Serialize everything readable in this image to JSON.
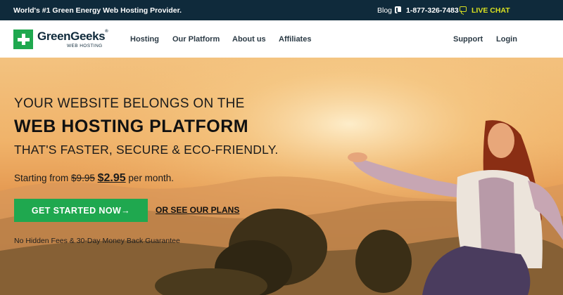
{
  "topbar": {
    "tagline": "World's #1 Green Energy Web Hosting Provider.",
    "blog": "Blog",
    "phone": "1-877-326-7483",
    "livechat": "LIVE CHAT"
  },
  "logo": {
    "name": "GreenGeeks",
    "reg": "®",
    "subtitle": "WEB HOSTING"
  },
  "nav": {
    "items": [
      "Hosting",
      "Our Platform",
      "About us",
      "Affiliates"
    ],
    "support": "Support",
    "login": "Login"
  },
  "hero": {
    "line1": "YOUR WEBSITE BELONGS ON THE",
    "line2": "WEB HOSTING PLATFORM",
    "line3": "THAT'S FASTER, SECURE & ECO-FRIENDLY.",
    "price_prefix": "Starting from",
    "price_old": "$9.95",
    "price_new": "$2.95",
    "price_suffix": "per month.",
    "cta": "GET STARTED NOW→",
    "plans": "OR SEE OUR PLANS",
    "guarantee": "No Hidden Fees & 30-Day Money Back Guarantee"
  },
  "colors": {
    "topbar": "#0f2a3b",
    "brand_green": "#1fa84f",
    "livechat": "#d8e021"
  }
}
